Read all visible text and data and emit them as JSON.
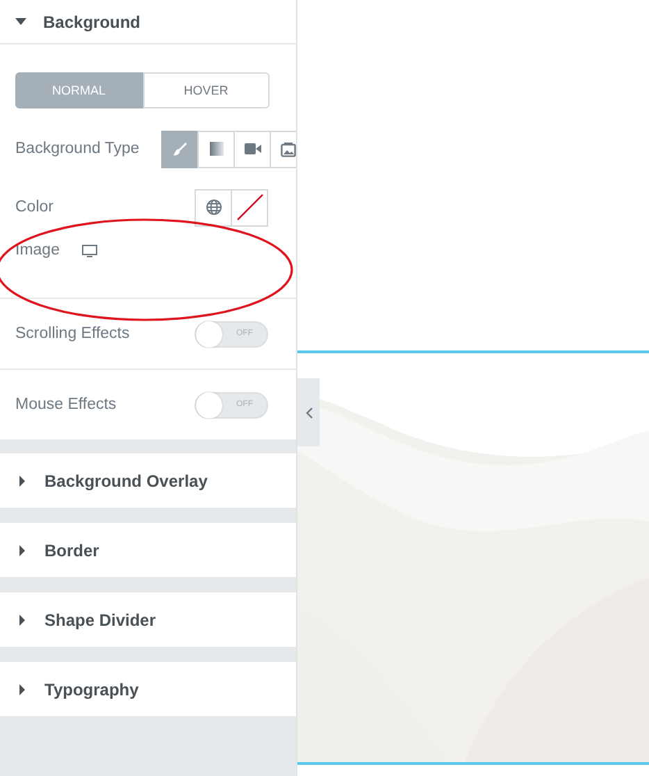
{
  "open_section": {
    "title": "Background",
    "expanded": true
  },
  "state_tabs": [
    {
      "label": "NORMAL",
      "selected": true
    },
    {
      "label": "HOVER",
      "selected": false
    }
  ],
  "background_type": {
    "label": "Background Type",
    "options": [
      {
        "kind": "brush",
        "selected": true
      },
      {
        "kind": "gradient",
        "selected": false
      },
      {
        "kind": "video",
        "selected": false
      },
      {
        "kind": "slideshow",
        "selected": false
      }
    ]
  },
  "color": {
    "label": "Color"
  },
  "image": {
    "label": "Image"
  },
  "toggles": [
    {
      "label": "Scrolling Effects",
      "on": false,
      "state_text": "OFF"
    },
    {
      "label": "Mouse Effects",
      "on": false,
      "state_text": "OFF"
    }
  ],
  "sections": [
    {
      "title": "Background Overlay",
      "expanded": false
    },
    {
      "title": "Border",
      "expanded": false
    },
    {
      "title": "Shape Divider",
      "expanded": false
    },
    {
      "title": "Typography",
      "expanded": false
    }
  ]
}
